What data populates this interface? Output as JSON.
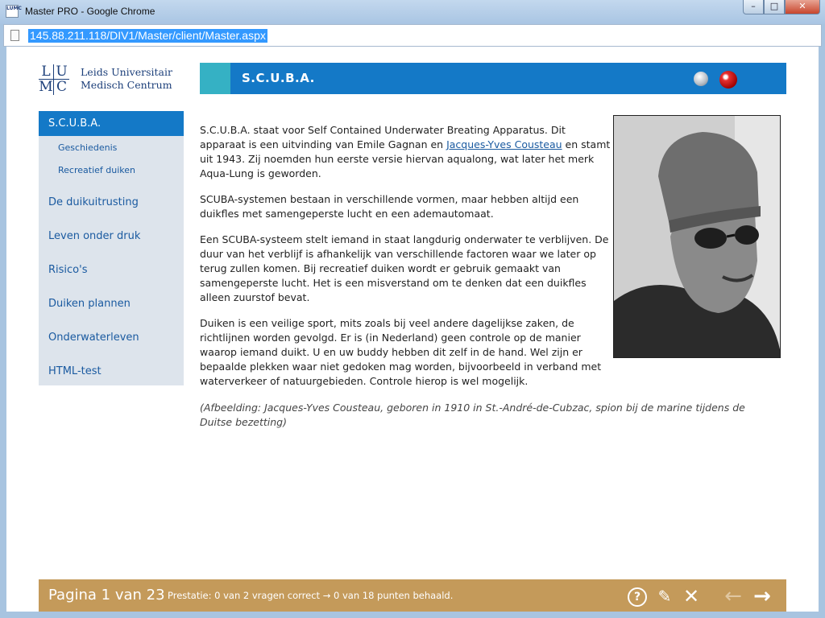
{
  "window": {
    "title": "Master PRO - Google Chrome",
    "app_icon_text": "LUMC",
    "controls": [
      "–",
      "□",
      "✕"
    ]
  },
  "browser": {
    "url": "145.88.211.118/DIV1/Master/client/Master.aspx"
  },
  "logo": {
    "letters": [
      "L",
      "U",
      "M",
      "C"
    ],
    "line1": "Leids Universitair",
    "line2": "Medisch Centrum"
  },
  "header": {
    "title": "S.C.U.B.A."
  },
  "sidebar": {
    "active": "S.C.U.B.A.",
    "subitems": [
      "Geschiedenis",
      "Recreatief duiken"
    ],
    "items": [
      "De duikuitrusting",
      "Leven onder druk",
      "Risico's",
      "Duiken plannen",
      "Onderwaterleven",
      "HTML-test"
    ]
  },
  "content": {
    "p1_before": "S.C.U.B.A. staat voor Self Contained Underwater Breating Apparatus. Dit apparaat is een uitvinding van Emile Gagnan en ",
    "p1_link": "Jacques-Yves Cousteau",
    "p1_after": " en stamt uit 1943. Zij noemden hun eerste versie hiervan aqualong, wat later het merk Aqua-Lung is geworden.",
    "p2": "SCUBA-systemen bestaan in verschillende vormen, maar hebben altijd een duikfles met samengeperste lucht en een ademautomaat.",
    "p3": "Een SCUBA-systeem stelt iemand in staat langdurig onderwater te verblijven. De duur van het verblijf is afhankelijk van verschillende factoren waar we later op terug zullen komen. Bij recreatief duiken wordt er gebruik gemaakt van samengeperste lucht. Het is een misverstand om te denken dat een duikfles alleen zuurstof bevat.",
    "p4": "Duiken is een veilige sport, mits zoals bij veel andere dagelijkse zaken, de richtlijnen worden gevolgd. Er is (in Nederland) geen controle op de manier waarop iemand duikt. U en uw buddy hebben dit zelf in de hand. Wel zijn er bepaalde plekken waar niet gedoken mag worden, bijvoorbeeld in verband met waterverkeer of natuurgebieden. Controle hierop is wel mogelijk.",
    "caption": "(Afbeelding: Jacques-Yves Cousteau, geboren in 1910 in St.-André-de-Cubzac, spion bij de marine tijdens de Duitse bezetting)"
  },
  "footer": {
    "page": "Pagina 1 van 23",
    "performance": "Prestatie: 0 van 2 vragen correct → 0 van 18 punten behaald.",
    "help_glyph": "?",
    "edit_glyph": "✎",
    "close_glyph": "✕",
    "prev_glyph": "←",
    "next_glyph": "→"
  },
  "colors": {
    "header": "#1479c7",
    "accent": "#35b1c4",
    "sidebar": "#dde4ec",
    "footer": "#c49a5a"
  }
}
